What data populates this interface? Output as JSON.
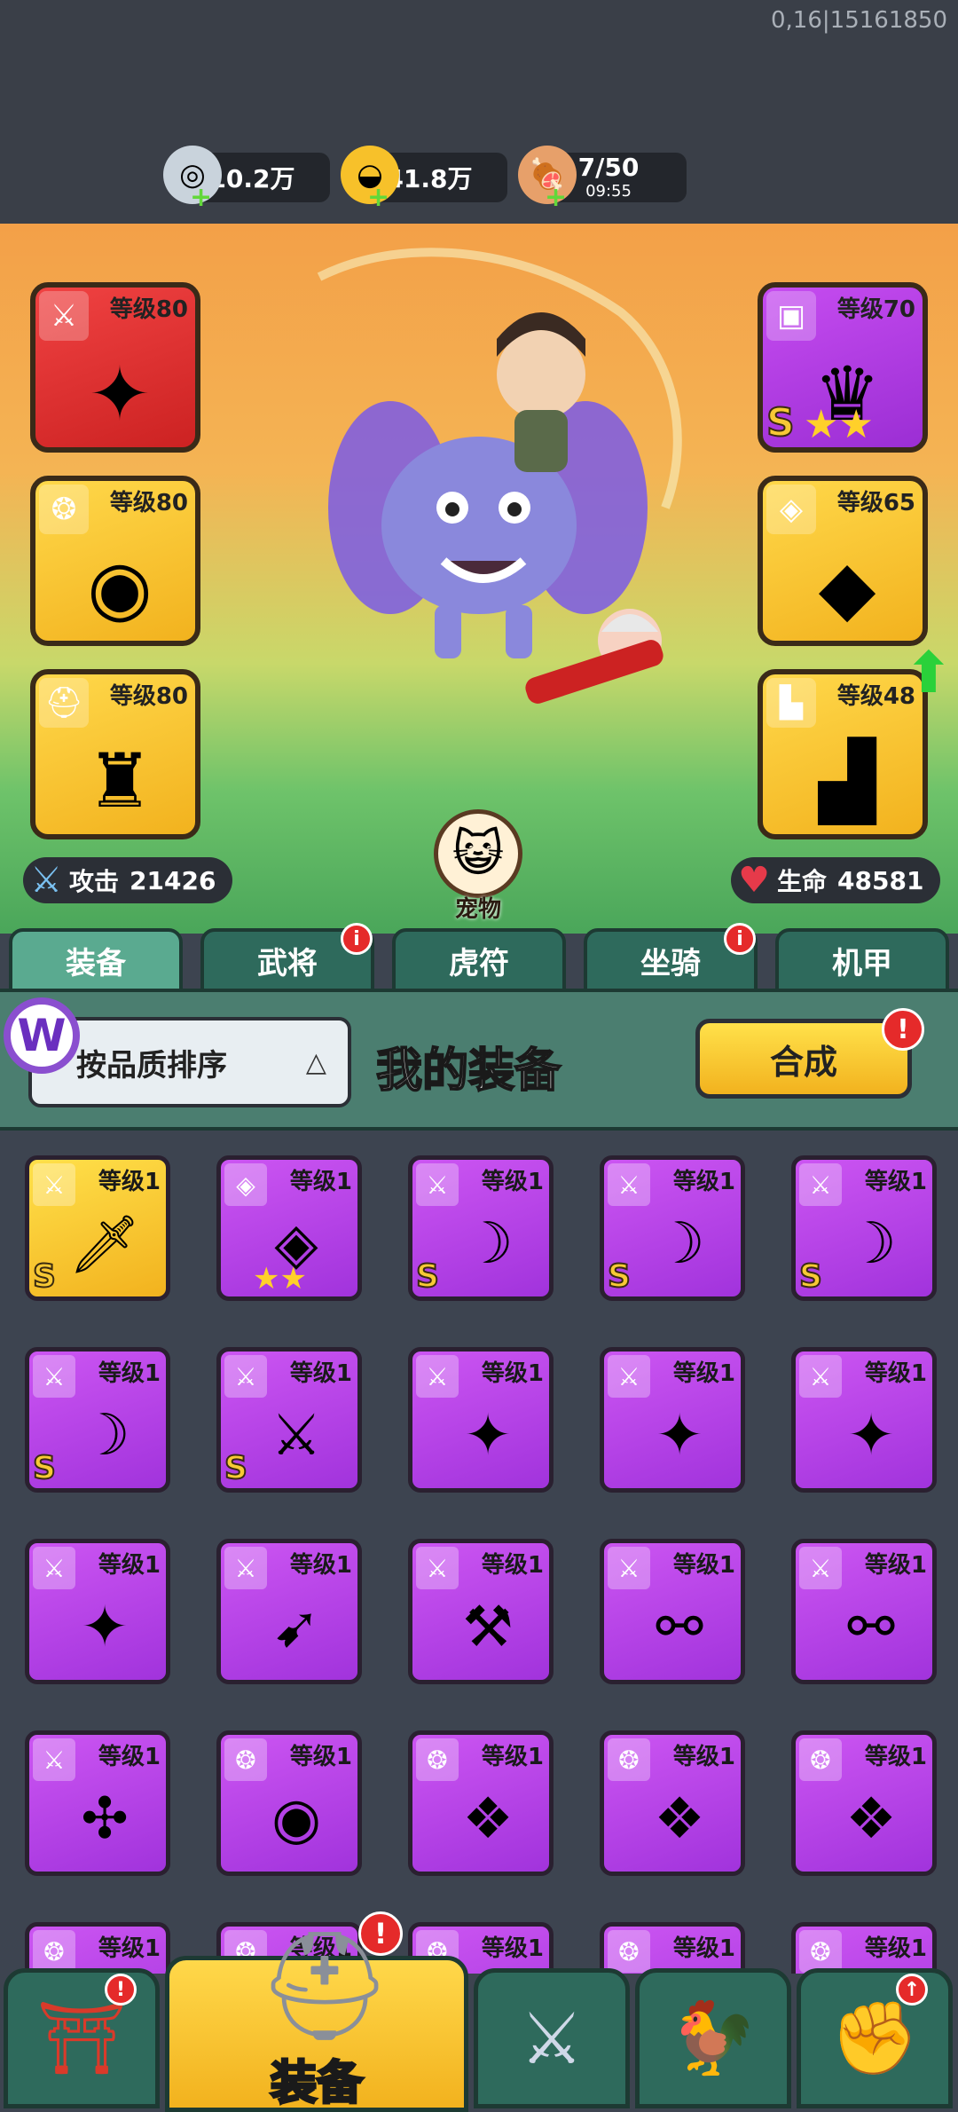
{
  "debug": {
    "text": "0,16|15161850"
  },
  "resources": [
    {
      "icon": "silver-coin-icon",
      "value": "10.2万"
    },
    {
      "icon": "gold-ingot-icon",
      "value": "41.8万"
    },
    {
      "icon": "meat-stamina-icon",
      "value": "7/50",
      "timer": "09:55"
    }
  ],
  "equipment_slots": {
    "left": [
      {
        "icon": "weapon-slot-icon",
        "level": "等级80",
        "item": "shuriken-icon",
        "color": "red"
      },
      {
        "icon": "necklace-slot-icon",
        "level": "等级80",
        "item": "amulet-icon",
        "color": "yellow"
      },
      {
        "icon": "helmet-slot-icon",
        "level": "等级80",
        "item": "helmet-icon",
        "color": "yellow"
      }
    ],
    "right": [
      {
        "icon": "armor-slot-icon",
        "level": "等级70",
        "item": "armor-icon",
        "color": "purple",
        "rank": "S",
        "stars": "★★"
      },
      {
        "icon": "bracer-slot-icon",
        "level": "等级65",
        "item": "bracer-icon",
        "color": "yellow"
      },
      {
        "icon": "boots-slot-icon",
        "level": "等级48",
        "item": "boots-icon",
        "color": "yellow"
      }
    ]
  },
  "stats": {
    "attack": {
      "label": "攻击",
      "value": "21426"
    },
    "hp": {
      "label": "生命",
      "value": "48581"
    }
  },
  "pet": {
    "label": "宠物"
  },
  "tabs": [
    {
      "label": "装备",
      "active": true,
      "badge": false
    },
    {
      "label": "武将",
      "active": false,
      "badge": true
    },
    {
      "label": "虎符",
      "active": false,
      "badge": false
    },
    {
      "label": "坐骑",
      "active": false,
      "badge": true
    },
    {
      "label": "机甲",
      "active": false,
      "badge": false
    }
  ],
  "bag": {
    "sort_label": "按品质排序",
    "title": "我的装备",
    "merge_label": "合成"
  },
  "items": [
    {
      "level": "等级1",
      "color": "yellow",
      "type": "weapon",
      "art": "blade",
      "rank": "S",
      "stars": ""
    },
    {
      "level": "等级1",
      "color": "purple",
      "type": "bracer",
      "art": "bracer",
      "rank": "",
      "stars": "★★"
    },
    {
      "level": "等级1",
      "color": "purple",
      "type": "weapon",
      "art": "scimitar",
      "rank": "S",
      "stars": ""
    },
    {
      "level": "等级1",
      "color": "purple",
      "type": "weapon",
      "art": "scimitar",
      "rank": "S",
      "stars": ""
    },
    {
      "level": "等级1",
      "color": "purple",
      "type": "weapon",
      "art": "scimitar",
      "rank": "S",
      "stars": ""
    },
    {
      "level": "等级1",
      "color": "purple",
      "type": "weapon",
      "art": "scimitar",
      "rank": "S",
      "stars": ""
    },
    {
      "level": "等级1",
      "color": "purple",
      "type": "weapon",
      "art": "swords",
      "rank": "S",
      "stars": ""
    },
    {
      "level": "等级1",
      "color": "purple",
      "type": "weapon",
      "art": "shuriken",
      "rank": "",
      "stars": ""
    },
    {
      "level": "等级1",
      "color": "purple",
      "type": "weapon",
      "art": "shuriken",
      "rank": "",
      "stars": ""
    },
    {
      "level": "等级1",
      "color": "purple",
      "type": "weapon",
      "art": "shuriken",
      "rank": "",
      "stars": ""
    },
    {
      "level": "等级1",
      "color": "purple",
      "type": "weapon",
      "art": "shuriken",
      "rank": "",
      "stars": ""
    },
    {
      "level": "等级1",
      "color": "purple",
      "type": "weapon",
      "art": "crossbow",
      "rank": "",
      "stars": ""
    },
    {
      "level": "等级1",
      "color": "purple",
      "type": "weapon",
      "art": "cannon",
      "rank": "",
      "stars": ""
    },
    {
      "level": "等级1",
      "color": "purple",
      "type": "weapon",
      "art": "glaive",
      "rank": "",
      "stars": ""
    },
    {
      "level": "等级1",
      "color": "purple",
      "type": "weapon",
      "art": "glaive",
      "rank": "",
      "stars": ""
    },
    {
      "level": "等级1",
      "color": "purple",
      "type": "weapon",
      "art": "triblade",
      "rank": "",
      "stars": ""
    },
    {
      "level": "等级1",
      "color": "purple",
      "type": "necklace",
      "art": "amulet",
      "rank": "",
      "stars": ""
    },
    {
      "level": "等级1",
      "color": "purple",
      "type": "necklace",
      "art": "pendant",
      "rank": "",
      "stars": ""
    },
    {
      "level": "等级1",
      "color": "purple",
      "type": "necklace",
      "art": "pendant",
      "rank": "",
      "stars": ""
    },
    {
      "level": "等级1",
      "color": "purple",
      "type": "necklace",
      "art": "pendant",
      "rank": "",
      "stars": ""
    },
    {
      "level": "等级1",
      "color": "purple",
      "type": "necklace",
      "art": "amulet",
      "rank": "",
      "stars": ""
    },
    {
      "level": "等级1",
      "color": "purple",
      "type": "necklace",
      "art": "amulet",
      "rank": "",
      "stars": ""
    },
    {
      "level": "等级1",
      "color": "purple",
      "type": "necklace",
      "art": "amulet",
      "rank": "",
      "stars": ""
    },
    {
      "level": "等级1",
      "color": "purple",
      "type": "necklace",
      "art": "amulet",
      "rank": "",
      "stars": ""
    },
    {
      "level": "等级1",
      "color": "purple",
      "type": "necklace",
      "art": "amulet",
      "rank": "",
      "stars": ""
    }
  ],
  "bottom_nav": [
    {
      "icon": "shop-gate-icon",
      "badge": true
    },
    {
      "icon": "helmet-equip-icon",
      "label": "装备",
      "badge": true,
      "active": true
    },
    {
      "icon": "crossed-swords-icon",
      "badge": false
    },
    {
      "icon": "rooster-icon",
      "badge": false
    },
    {
      "icon": "upgrade-fist-icon",
      "badge": true
    }
  ],
  "colors": {
    "yellow": "#f2b21e",
    "purple": "#a133dc",
    "red": "#cc2222",
    "tab_green": "#2e6a5c",
    "badge_red": "#e52a2a"
  }
}
